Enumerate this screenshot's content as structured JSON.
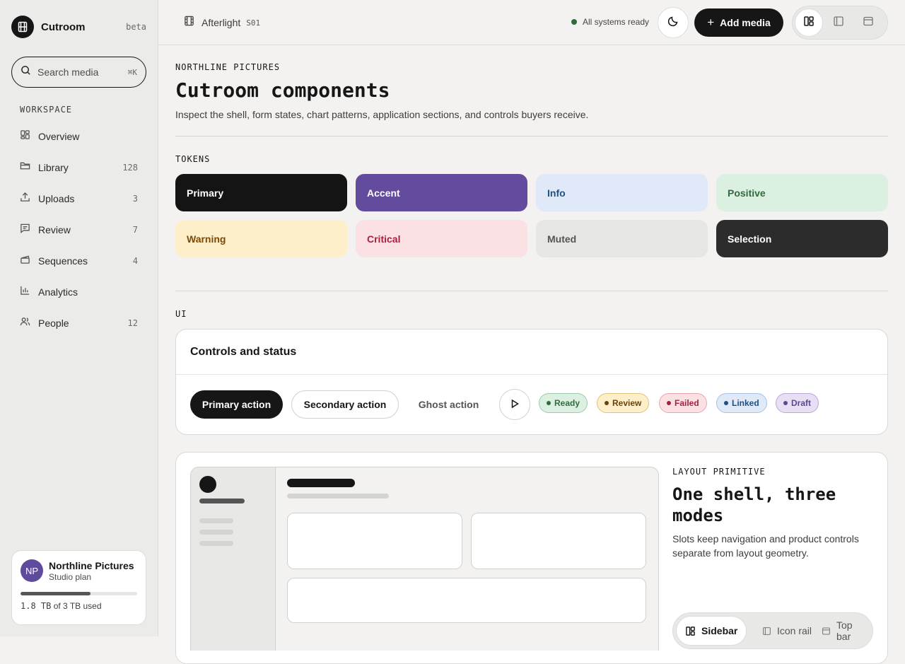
{
  "brand": {
    "name": "Cutroom",
    "tag": "beta"
  },
  "search": {
    "placeholder": "Search media",
    "shortcut": "⌘K"
  },
  "sidebar": {
    "section_label": "WORKSPACE",
    "items": [
      {
        "label": "Overview",
        "count": "",
        "icon": "grid-icon"
      },
      {
        "label": "Library",
        "count": "128",
        "icon": "folder-icon"
      },
      {
        "label": "Uploads",
        "count": "3",
        "icon": "upload-icon"
      },
      {
        "label": "Review",
        "count": "7",
        "icon": "comment-icon"
      },
      {
        "label": "Sequences",
        "count": "4",
        "icon": "clapper-icon"
      },
      {
        "label": "Analytics",
        "count": "",
        "icon": "bar-chart-icon"
      },
      {
        "label": "People",
        "count": "12",
        "icon": "people-icon"
      }
    ]
  },
  "account": {
    "initials": "NP",
    "name": "Northline Pictures",
    "plan": "Studio plan",
    "storage_used": "1.8 TB",
    "storage_rest": "of 3 TB used",
    "storage_fraction": 0.6
  },
  "topbar": {
    "project": "Afterlight",
    "episode": "S01",
    "status": "All systems ready",
    "add_label": "Add media",
    "modes": [
      "sidebar-layout-icon",
      "icon-rail-layout-icon",
      "top-bar-layout-icon"
    ],
    "active_mode": 0
  },
  "page": {
    "eyebrow": "NORTHLINE PICTURES",
    "title": "Cutroom components",
    "description": "Inspect the shell, form states, chart patterns, application sections, and controls buyers receive."
  },
  "tokens": {
    "label": "TOKENS",
    "items": [
      {
        "label": "Primary",
        "bg": "#141414",
        "fg": "#ffffff"
      },
      {
        "label": "Accent",
        "bg": "#634c9e",
        "fg": "#ffffff"
      },
      {
        "label": "Info",
        "bg": "#dfe9f8",
        "fg": "#1f4f86"
      },
      {
        "label": "Positive",
        "bg": "#dcf0e2",
        "fg": "#2f6b3d"
      },
      {
        "label": "Warning",
        "bg": "#fcefc9",
        "fg": "#7a4a08"
      },
      {
        "label": "Critical",
        "bg": "#fbe0e4",
        "fg": "#a12340"
      },
      {
        "label": "Muted",
        "bg": "#e6e6e4",
        "fg": "#555555"
      },
      {
        "label": "Selection",
        "bg": "#2c2c2c",
        "fg": "#ffffff"
      }
    ]
  },
  "ui": {
    "label": "UI",
    "controls_title": "Controls and status",
    "primary_action": "Primary action",
    "secondary_action": "Secondary action",
    "ghost_action": "Ghost action",
    "badges": [
      {
        "label": "Ready",
        "bg": "#dcf0e2",
        "fg": "#2f6b3d",
        "border": "#9dcaa9"
      },
      {
        "label": "Review",
        "bg": "#fcefc9",
        "fg": "#6b4308",
        "border": "#e0c27a"
      },
      {
        "label": "Failed",
        "bg": "#fbe0e4",
        "fg": "#a12340",
        "border": "#e5a6b2"
      },
      {
        "label": "Linked",
        "bg": "#dfe9f8",
        "fg": "#1f4f86",
        "border": "#a6c2e6"
      },
      {
        "label": "Draft",
        "bg": "#e7e0f5",
        "fg": "#5b4a8f",
        "border": "#b6a7d8"
      }
    ]
  },
  "layout_primitive": {
    "eyebrow": "LAYOUT PRIMITIVE",
    "title": "One shell, three modes",
    "description": "Slots keep navigation and product controls separate from layout geometry.",
    "modes": [
      "Sidebar",
      "Icon rail",
      "Top bar"
    ],
    "active_mode": 0
  }
}
